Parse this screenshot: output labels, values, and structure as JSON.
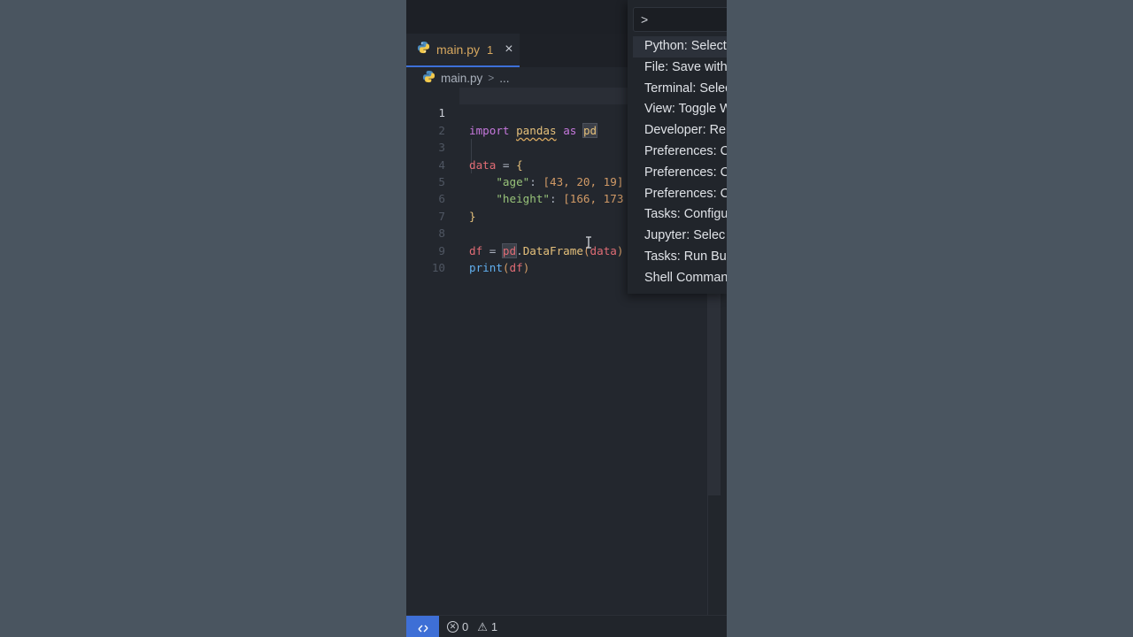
{
  "colors": {
    "background": "#4a5560",
    "editor_bg": "#23272e",
    "accent": "#3e6fd6",
    "keyword": "#c678dd",
    "variable": "#e06c75",
    "string": "#98c379",
    "number": "#d19a66",
    "function": "#61afef",
    "modified_tab": "#d7a85f"
  },
  "tab": {
    "icon": "python-icon",
    "label": "main.py",
    "problem_count": "1",
    "close": "×"
  },
  "breadcrumb": {
    "file": "main.py",
    "separator": ">",
    "more": "..."
  },
  "editor": {
    "line_numbers": [
      "1",
      "2",
      "3",
      "4",
      "5",
      "6",
      "7",
      "8",
      "9",
      "10"
    ],
    "active_line": "1",
    "tokens": {
      "l1_import": "import",
      "l1_module": "pandas",
      "l1_as": "as",
      "l1_alias": "pd",
      "l3_var": "data",
      "l3_eq": " = ",
      "l3_brace": "{",
      "l4_key": "\"age\"",
      "l4_colon": ": ",
      "l4_vals": "[43, 20, 19]",
      "l5_key": "\"height\"",
      "l5_colon": ": ",
      "l5_vals": "[166, 173",
      "l6_brace": "}",
      "l8_var": "df",
      "l8_eq": " = ",
      "l8_pd": "pd",
      "l8_dot": ".",
      "l8_fn": "DataFrame",
      "l8_paren_open": "(",
      "l8_arg": "data",
      "l8_paren_close": ")",
      "l9_fn": "print",
      "l9_paren_open": "(",
      "l9_arg": "df",
      "l9_paren_close": ")"
    }
  },
  "command_palette": {
    "input_value": ">",
    "items": [
      "Python: Select",
      "File: Save with",
      "Terminal: Selec",
      "View: Toggle W",
      "Developer: Rel",
      "Preferences: C",
      "Preferences: C",
      "Preferences: C",
      "Tasks: Configu",
      "Jupyter: Selec",
      "Tasks: Run Bui",
      "Shell Comman"
    ]
  },
  "statusbar": {
    "remote_icon": "remote-icon",
    "errors": "0",
    "warnings": "1"
  }
}
